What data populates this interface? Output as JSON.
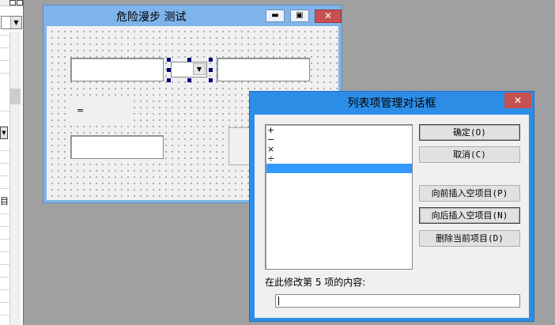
{
  "form_window": {
    "title": "危险漫步 测试",
    "controls": {
      "operator_label": "="
    }
  },
  "dialog": {
    "title": "列表项管理对话框",
    "list_items": [
      "+",
      "−",
      "×",
      "÷",
      ""
    ],
    "selected_index": 4,
    "buttons": {
      "ok": "确定(O)",
      "cancel": "取消(C)",
      "insert_before": "向前插入空项目(P)",
      "insert_after": "向后插入空项目(N)",
      "delete": "删除当前项目(D)"
    },
    "edit_prompt": "在此修改第 5 项的内容:",
    "edit_value": ""
  },
  "left_panel": {
    "cut_text": "目"
  },
  "colors": {
    "dialog_frame": "#2d8ee8",
    "form_frame": "#7eb4ea",
    "close_red": "#c75050",
    "selection": "#3399ff",
    "handle": "#000080"
  }
}
